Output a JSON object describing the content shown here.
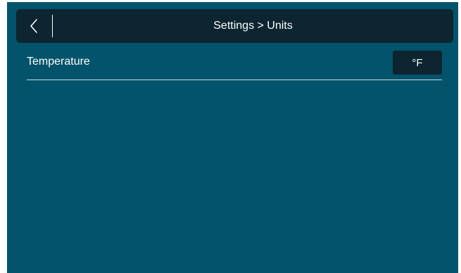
{
  "header": {
    "title": "Settings > Units",
    "back_icon": "chevron-left-icon"
  },
  "settings": {
    "temperature": {
      "label": "Temperature",
      "value": "°F"
    }
  },
  "colors": {
    "background": "#02536b",
    "header_background": "#0c2530",
    "button_background": "#0c2530",
    "text": "#ffffff",
    "divider": "#c9dde3"
  }
}
